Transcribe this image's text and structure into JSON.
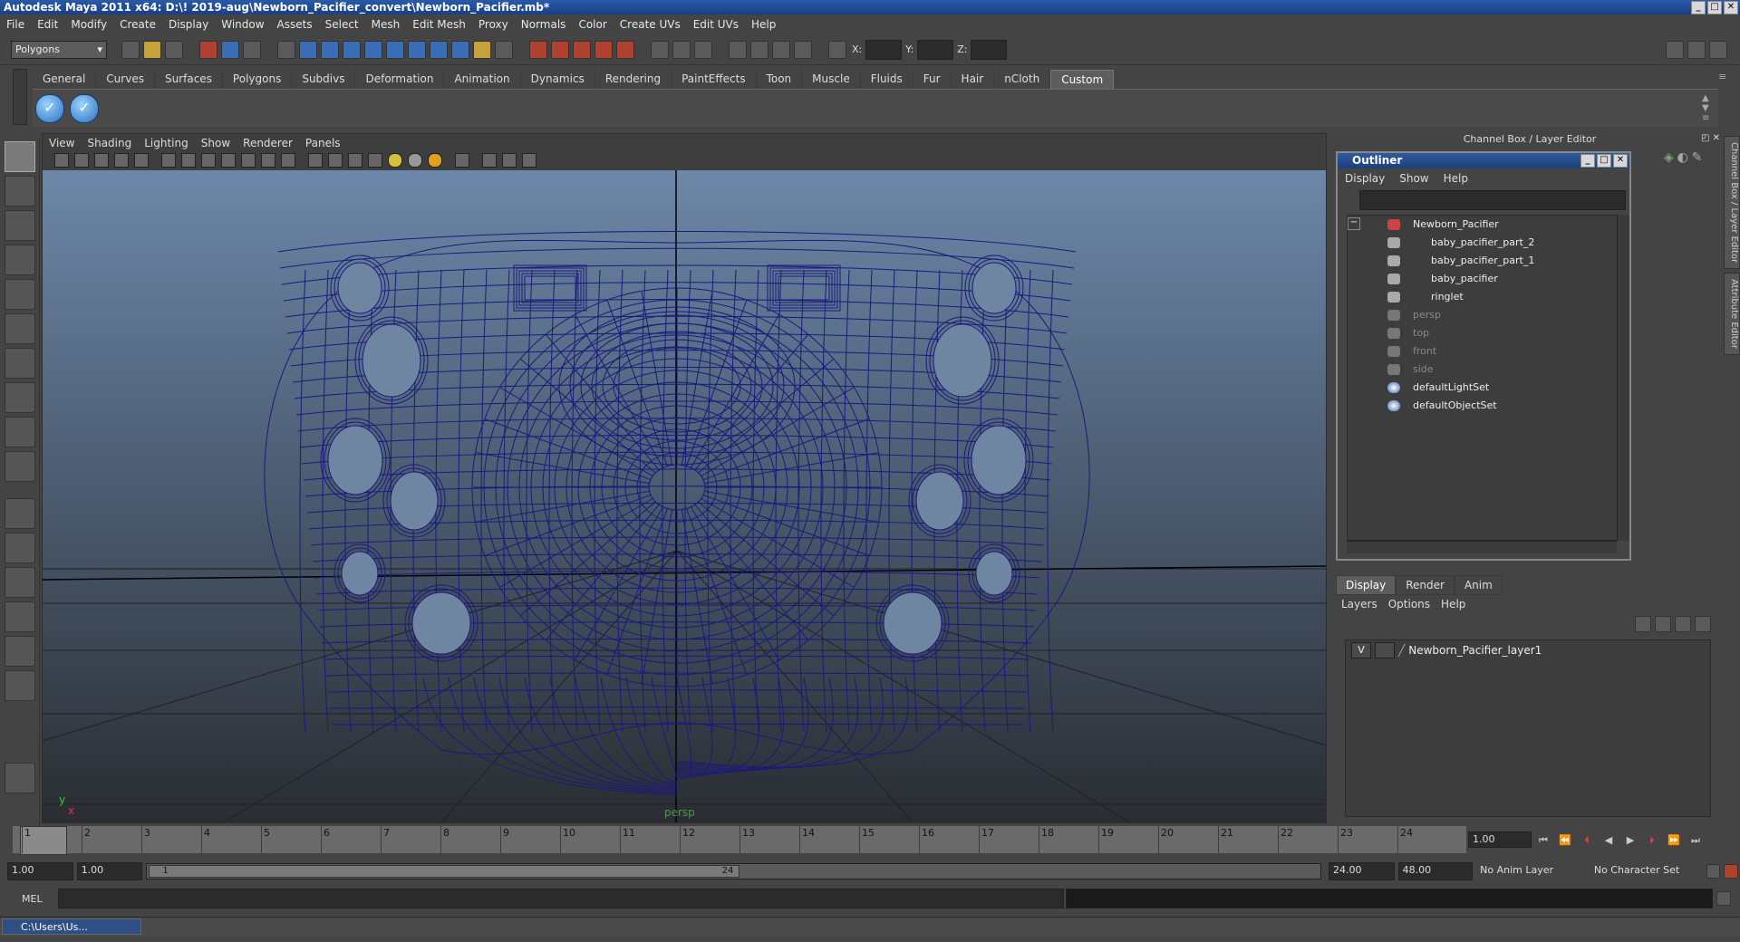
{
  "window": {
    "title": "Autodesk Maya 2011 x64: D:\\! 2019-aug\\Newborn_Pacifier_convert\\Newborn_Pacifier.mb*"
  },
  "menubar": [
    "File",
    "Edit",
    "Modify",
    "Create",
    "Display",
    "Window",
    "Assets",
    "Select",
    "Mesh",
    "Edit Mesh",
    "Proxy",
    "Normals",
    "Color",
    "Create UVs",
    "Edit UVs",
    "Help"
  ],
  "statusline": {
    "mode": "Polygons",
    "x_label": "X:",
    "y_label": "Y:",
    "z_label": "Z:"
  },
  "shelf_tabs": [
    "General",
    "Curves",
    "Surfaces",
    "Polygons",
    "Subdivs",
    "Deformation",
    "Animation",
    "Dynamics",
    "Rendering",
    "PaintEffects",
    "Toon",
    "Muscle",
    "Fluids",
    "Fur",
    "Hair",
    "nCloth",
    "Custom"
  ],
  "active_shelf": "Custom",
  "viewport": {
    "menu": [
      "View",
      "Shading",
      "Lighting",
      "Show",
      "Renderer",
      "Panels"
    ],
    "camera_label": "persp",
    "axis_y": "y",
    "axis_x": "x",
    "wire_color": "#1a1a7a"
  },
  "channel_box": {
    "header": "Channel Box / Layer Editor"
  },
  "outliner": {
    "title": "Outliner",
    "menu": [
      "Display",
      "Show",
      "Help"
    ],
    "items": [
      {
        "label": "Newborn_Pacifier",
        "depth": 0,
        "dim": false
      },
      {
        "label": "baby_pacifier_part_2",
        "depth": 1,
        "dim": false
      },
      {
        "label": "baby_pacifier_part_1",
        "depth": 1,
        "dim": false
      },
      {
        "label": "baby_pacifier",
        "depth": 1,
        "dim": false
      },
      {
        "label": "ringlet",
        "depth": 1,
        "dim": false
      },
      {
        "label": "persp",
        "depth": 0,
        "dim": true
      },
      {
        "label": "top",
        "depth": 0,
        "dim": true
      },
      {
        "label": "front",
        "depth": 0,
        "dim": true
      },
      {
        "label": "side",
        "depth": 0,
        "dim": true
      },
      {
        "label": "defaultLightSet",
        "depth": 0,
        "dim": false
      },
      {
        "label": "defaultObjectSet",
        "depth": 0,
        "dim": false
      }
    ]
  },
  "layer_editor": {
    "tabs": [
      "Display",
      "Render",
      "Anim"
    ],
    "menu": [
      "Layers",
      "Options",
      "Help"
    ],
    "layer": {
      "visible": "V",
      "name": "Newborn_Pacifier_layer1"
    }
  },
  "side_tabs": [
    "Channel Box / Layer Editor",
    "Attribute Editor"
  ],
  "timeline": {
    "frames": [
      "1",
      "2",
      "3",
      "4",
      "5",
      "6",
      "7",
      "8",
      "9",
      "10",
      "11",
      "12",
      "13",
      "14",
      "15",
      "16",
      "17",
      "18",
      "19",
      "20",
      "21",
      "22",
      "23",
      "24"
    ],
    "current_frame": "1.00"
  },
  "range": {
    "start": "1.00",
    "playback_start": "1.00",
    "slider_start": "1",
    "slider_end": "24",
    "playback_end": "24.00",
    "end": "48.00",
    "anim_layer": "No Anim Layer",
    "character_set": "No Character Set"
  },
  "command_line": {
    "label": "MEL"
  },
  "taskbar": {
    "item": "C:\\Users\\Us..."
  }
}
